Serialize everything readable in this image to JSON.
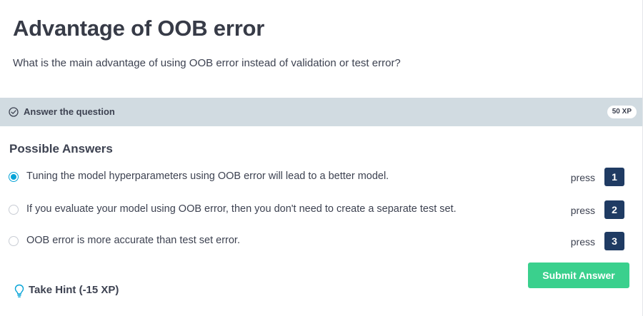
{
  "exercise": {
    "title": "Advantage of OOB error",
    "question": "What is the main advantage of using OOB error instead of validation or test error?"
  },
  "instruction_bar": {
    "label": "Answer the question",
    "icon": "check-circle-icon",
    "xp_badge": "50 XP",
    "background_color": "#d1dbe1"
  },
  "answers": {
    "heading": "Possible Answers",
    "selected_index": 0,
    "items": [
      {
        "text": "Tuning the model hyperparameters using OOB error will lead to a better model.",
        "press_label": "press",
        "key": "1",
        "selected": true
      },
      {
        "text": "If you evaluate your model using OOB error, then you don't need to create a separate test set.",
        "press_label": "press",
        "key": "2",
        "selected": false
      },
      {
        "text": "OOB error is more accurate than test set error.",
        "press_label": "press",
        "key": "3",
        "selected": false
      }
    ]
  },
  "actions": {
    "submit_label": "Submit Answer",
    "submit_color": "#3ad08d",
    "hint_label": "Take Hint (-15 XP)",
    "hint_icon": "lightbulb-icon"
  },
  "colors": {
    "accent": "#05a3d7",
    "key_badge": "#1f3b63",
    "text": "#3d4251"
  }
}
